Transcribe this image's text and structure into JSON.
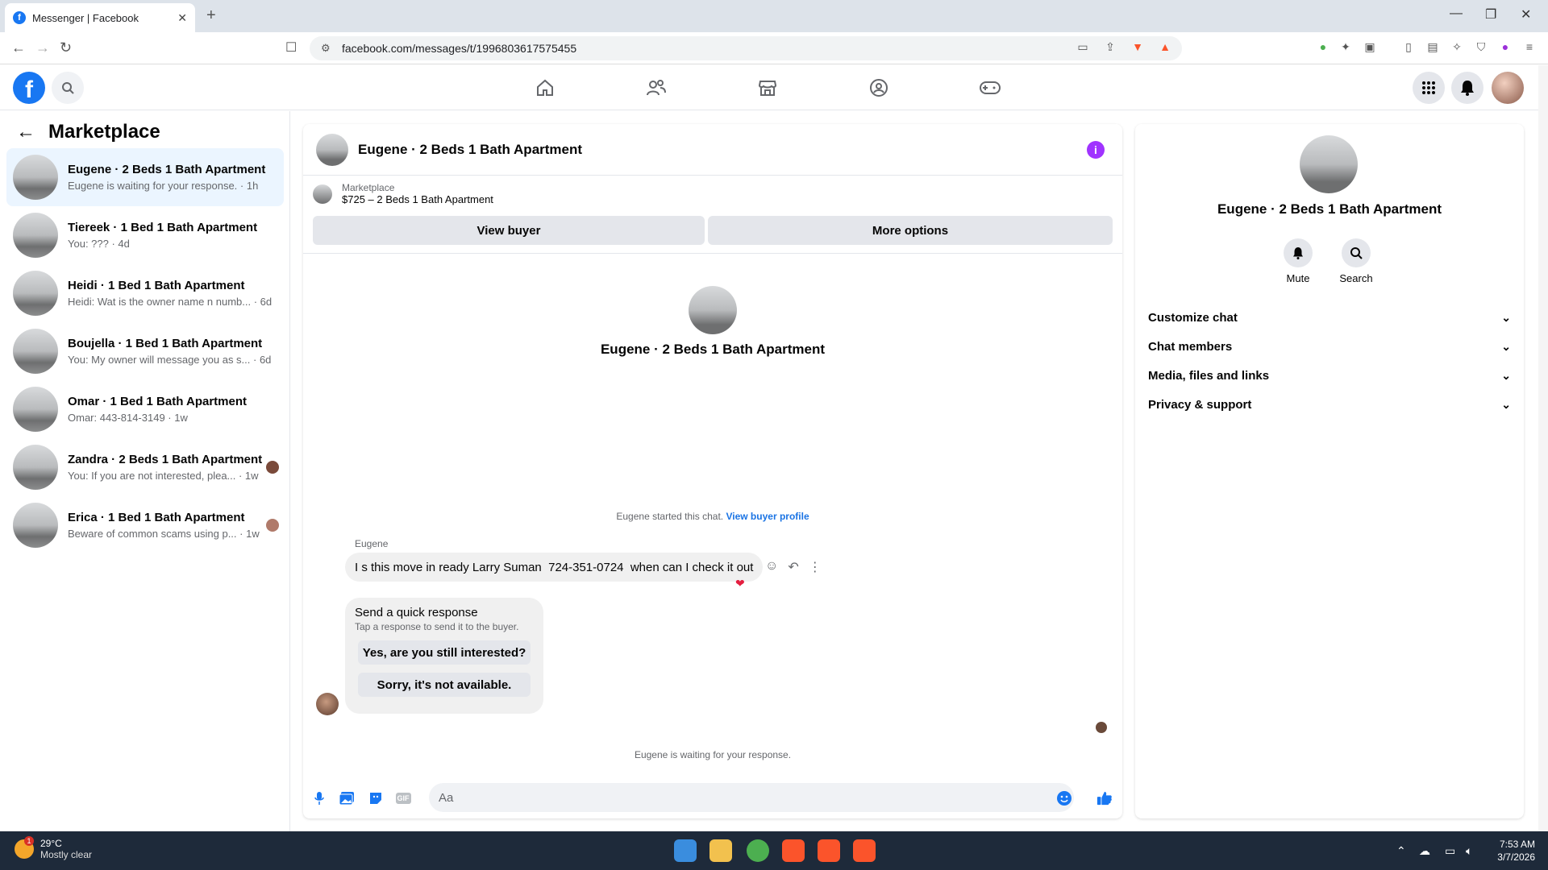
{
  "browser": {
    "tab_title": "Messenger | Facebook",
    "new_tab": "+",
    "url": "facebook.com/messages/t/1996803617575455",
    "badge_count": "1"
  },
  "fb": {
    "logo_letter": "f"
  },
  "left_panel": {
    "title": "Marketplace",
    "conversations": [
      {
        "name": "Eugene · 2 Beds 1 Bath Apartment",
        "preview": "Eugene is waiting for your response. · 1h"
      },
      {
        "name": "Tiereek · 1 Bed 1 Bath Apartment",
        "preview": "You: ??? · 4d"
      },
      {
        "name": "Heidi · 1 Bed 1 Bath Apartment",
        "preview": "Heidi: Wat is the owner name n numb... · 6d"
      },
      {
        "name": "Boujella · 1 Bed 1 Bath Apartment",
        "preview": "You: My owner will message you as s... · 6d"
      },
      {
        "name": "Omar · 1 Bed 1 Bath Apartment",
        "preview": "Omar: 443-814-3149 · 1w"
      },
      {
        "name": "Zandra · 2 Beds 1 Bath Apartment",
        "preview": "You: If you are not interested, plea... · 1w"
      },
      {
        "name": "Erica · 1 Bed 1 Bath Apartment",
        "preview": "Beware of common scams using p... · 1w"
      }
    ]
  },
  "chat": {
    "title": "Eugene · 2 Beds 1 Bath Apartment",
    "info_icon": "i",
    "marketplace_label": "Marketplace",
    "listing": "$725 – 2 Beds 1 Bath Apartment",
    "view_buyer": "View buyer",
    "more_options": "More options",
    "center_name": "Eugene · 2 Beds 1 Bath Apartment",
    "started_text": "Eugene started this chat.",
    "view_buyer_profile": "View buyer profile",
    "sender": "Eugene",
    "message": "I s this move in ready Larry Suman  724-351-0724  when can I check it out",
    "quick_title": "Send a quick response",
    "quick_sub": "Tap a response to send it to the buyer.",
    "quick_1": "Yes, are you still interested?",
    "quick_2": "Sorry, it's not available.",
    "waiting": "Eugene is waiting for your response.",
    "composer_placeholder": "Aa",
    "gif_label": "GIF"
  },
  "right_panel": {
    "name": "Eugene · 2 Beds 1 Bath Apartment",
    "mute": "Mute",
    "search": "Search",
    "rows": [
      "Customize chat",
      "Chat members",
      "Media, files and links",
      "Privacy & support"
    ]
  },
  "taskbar": {
    "temp": "29°C",
    "condition": "Mostly clear",
    "weather_badge": "1",
    "time": "7:53 AM",
    "date": "3/7/2026"
  },
  "colors": {
    "fb_blue": "#1877f2",
    "info_purple": "#a033ff",
    "heart_red": "#e41e3f",
    "active_row": "#ebf5ff"
  }
}
